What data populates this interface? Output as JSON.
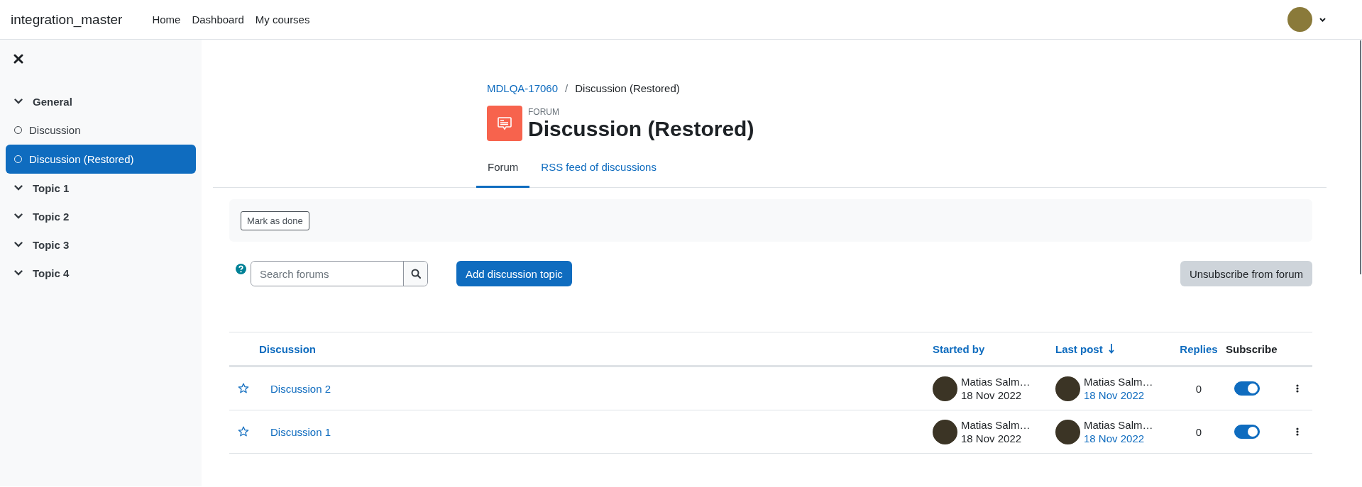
{
  "navbar": {
    "brand": "integration_master",
    "links": [
      "Home",
      "Dashboard",
      "My courses"
    ]
  },
  "sidebar": {
    "sections": [
      {
        "label": "General",
        "expanded": true,
        "children": [
          {
            "label": "Discussion",
            "selected": false
          },
          {
            "label": "Discussion (Restored)",
            "selected": true
          }
        ]
      },
      {
        "label": "Topic 1",
        "expanded": true
      },
      {
        "label": "Topic 2",
        "expanded": true
      },
      {
        "label": "Topic 3",
        "expanded": true
      },
      {
        "label": "Topic 4",
        "expanded": true
      }
    ]
  },
  "header": {
    "breadcrumb": [
      {
        "label": "MDLQA-17060",
        "kind": "link"
      },
      {
        "label": "/",
        "kind": "separator"
      },
      {
        "label": "Discussion (Restored)",
        "kind": "current"
      }
    ],
    "activity_type": "FORUM",
    "title": "Discussion (Restored)"
  },
  "tabs": [
    {
      "label": "Forum",
      "selected": true
    },
    {
      "label": "RSS feed of discussions",
      "selected": false
    }
  ],
  "completion": {
    "button": "Mark as done"
  },
  "toolbar": {
    "search_placeholder": "Search forums",
    "add_button": "Add discussion topic",
    "unsubscribe_button": "Unsubscribe from forum"
  },
  "table": {
    "columns": [
      {
        "label": "Discussion",
        "kind": "sortable"
      },
      {
        "label": "Started by",
        "kind": "sortable"
      },
      {
        "label": "Last post",
        "kind": "sortable",
        "sorted": true
      },
      {
        "label": "Replies",
        "kind": "sortable"
      },
      {
        "label": "Subscribe",
        "kind": "plain"
      }
    ],
    "rows": [
      {
        "starred": false,
        "title": "Discussion 2",
        "started_by": {
          "name": "Matias Salm…",
          "date": "18 Nov 2022"
        },
        "last_post": {
          "name": "Matias Salm…",
          "date": "18 Nov 2022"
        },
        "replies": "0",
        "subscribed": true
      },
      {
        "starred": false,
        "title": "Discussion 1",
        "started_by": {
          "name": "Matias Salm…",
          "date": "18 Nov 2022"
        },
        "last_post": {
          "name": "Matias Salm…",
          "date": "18 Nov 2022"
        },
        "replies": "0",
        "subscribed": true
      }
    ]
  }
}
